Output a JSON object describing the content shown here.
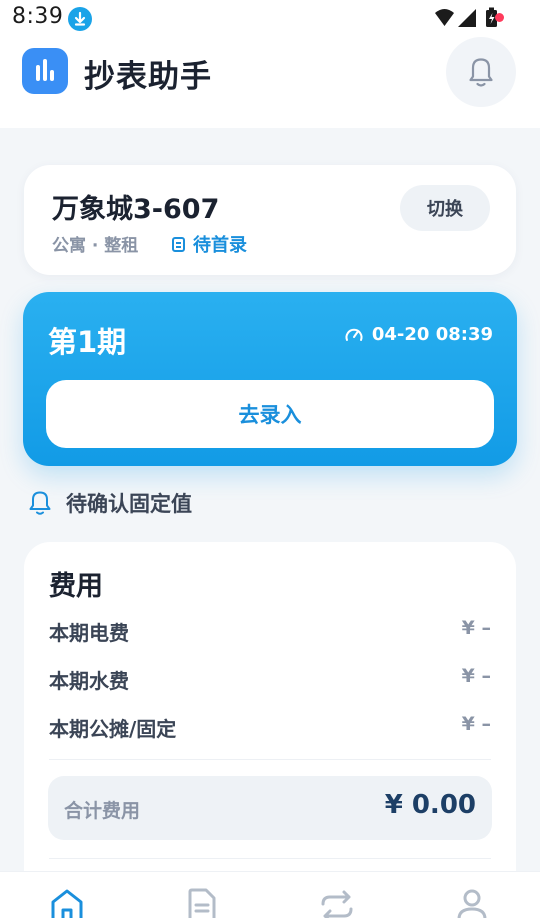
{
  "status_bar": {
    "time": "8:39"
  },
  "header": {
    "app_title": "抄表助手"
  },
  "property": {
    "name": "万象城3-607",
    "type": "公寓 · 整租",
    "status": "待首录",
    "switch_label": "切换"
  },
  "period": {
    "title": "第1期",
    "datetime": "04-20 08:39",
    "record_label": "去录入"
  },
  "notice": {
    "text": "待确认固定值"
  },
  "fees": {
    "title": "费用",
    "items": [
      {
        "label": "本期电费",
        "value": "¥ –"
      },
      {
        "label": "本期水费",
        "value": "¥ –"
      },
      {
        "label": "本期公摊/固定",
        "value": "¥ –"
      }
    ],
    "total_label": "合计费用",
    "total_value": "¥ 0.00"
  },
  "colors": {
    "accent": "#1a8fdc",
    "card_gradient_top": "#2ab0f0",
    "card_gradient_bottom": "#129be6",
    "notification_dot": "#ff3b5c"
  },
  "nav": {
    "active": "home",
    "items": [
      {
        "icon": "home-icon"
      },
      {
        "icon": "document-icon"
      },
      {
        "icon": "swap-icon"
      },
      {
        "icon": "user-icon"
      }
    ]
  }
}
